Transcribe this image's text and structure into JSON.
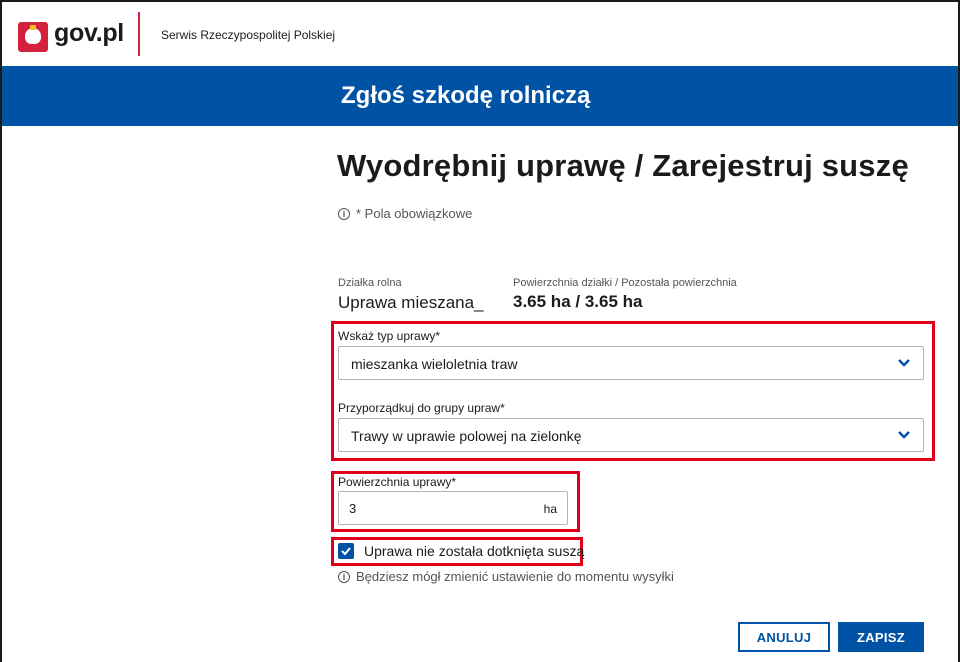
{
  "topbar": {
    "logo_text": "gov.pl",
    "service_name": "Serwis Rzeczypospolitej Polskiej"
  },
  "header": {
    "title": "Zgłoś szkodę rolniczą"
  },
  "page": {
    "title": "Wyodrębnij uprawę / Zarejestruj suszę",
    "required_note": "* Pola obowiązkowe"
  },
  "parcel": {
    "label": "Działka rolna",
    "value": "Uprawa mieszana_",
    "area_label": "Powierzchnia działki / Pozostała powierzchnia",
    "area_value": "3.65 ha / 3.65 ha"
  },
  "form": {
    "crop_type": {
      "label": "Wskaż typ uprawy*",
      "value": "mieszanka wieloletnia traw"
    },
    "crop_group": {
      "label": "Przyporządkuj do grupy upraw*",
      "value": "Trawy w uprawie polowej na zielonkę"
    },
    "crop_area": {
      "label": "Powierzchnia uprawy*",
      "value": "3",
      "unit": "ha"
    },
    "drought_checkbox": {
      "label": "Uprawa nie została dotknięta suszą",
      "checked": true
    },
    "hint": "Będziesz mógł zmienić ustawienie do momentu wysyłki"
  },
  "actions": {
    "cancel_label": "ANULUJ",
    "save_label": "ZAPISZ"
  },
  "colors": {
    "brand_blue": "#0052a5",
    "highlight_red": "#e0001b",
    "logo_red": "#d4213d"
  }
}
